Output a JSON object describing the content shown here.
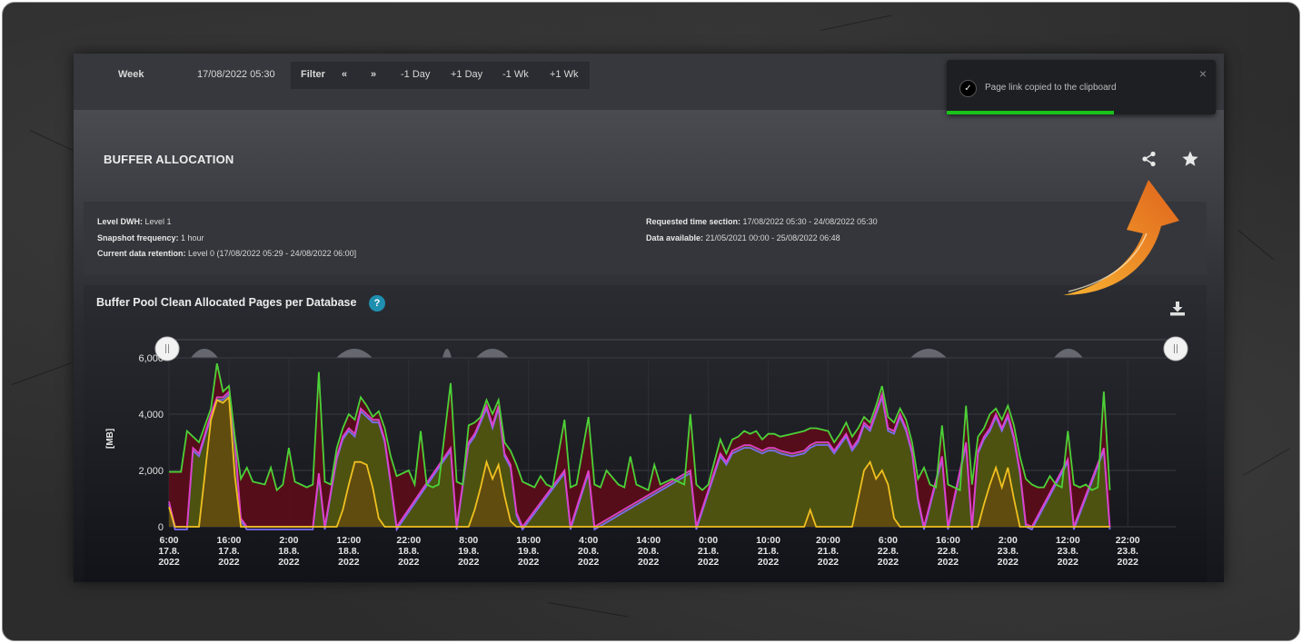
{
  "topbar": {
    "period_label": "Week",
    "datetime": "17/08/2022 05:30",
    "filter_label": "Filter",
    "nav_prev": "«",
    "nav_next": "»",
    "minus_day": "-1 Day",
    "plus_day": "+1 Day",
    "minus_week": "-1 Wk",
    "plus_week": "+1 Wk"
  },
  "toast": {
    "message": "Page link copied to the clipboard",
    "close": "×",
    "progress": 0.62
  },
  "section": {
    "title": "BUFFER ALLOCATION",
    "share_icon": "share-icon",
    "favorite_icon": "star-icon"
  },
  "info": {
    "level_label": "Level DWH:",
    "level_value": "Level 1",
    "snapshot_label": "Snapshot frequency:",
    "snapshot_value": "1 hour",
    "retention_label": "Current data retention:",
    "retention_value": "Level 0 (17/08/2022 05:29 - 24/08/2022 06:00]",
    "requested_label": "Requested time section:",
    "requested_value": "17/08/2022 05:30 - 24/08/2022 05:30",
    "available_label": "Data available:",
    "available_value": "21/05/2021 00:00 - 25/08/2022 06:48"
  },
  "chart": {
    "title": "Buffer Pool Clean Allocated Pages per Database",
    "help": "?",
    "download_icon": "download-icon",
    "colors": {
      "total": "#4cd137",
      "magenta": "#e040c8",
      "blue": "#7b6cf0",
      "yellow": "#f0c020",
      "base_fill": "#5a0d1a",
      "green_fill": "#4c5a10"
    }
  },
  "chart_data": {
    "type": "area",
    "ylabel": "[MB]",
    "ylim": [
      0,
      6000
    ],
    "yticks": [
      "0",
      "2,000",
      "4,000",
      "6,000"
    ],
    "grid": true,
    "xticks": [
      [
        "6:00",
        "17.8.",
        "2022"
      ],
      [
        "16:00",
        "17.8.",
        "2022"
      ],
      [
        "2:00",
        "18.8.",
        "2022"
      ],
      [
        "12:00",
        "18.8.",
        "2022"
      ],
      [
        "22:00",
        "18.8.",
        "2022"
      ],
      [
        "8:00",
        "19.8.",
        "2022"
      ],
      [
        "18:00",
        "19.8.",
        "2022"
      ],
      [
        "4:00",
        "20.8.",
        "2022"
      ],
      [
        "14:00",
        "20.8.",
        "2022"
      ],
      [
        "0:00",
        "21.8.",
        "2022"
      ],
      [
        "10:00",
        "21.8.",
        "2022"
      ],
      [
        "20:00",
        "21.8.",
        "2022"
      ],
      [
        "6:00",
        "22.8.",
        "2022"
      ],
      [
        "16:00",
        "22.8.",
        "2022"
      ],
      [
        "2:00",
        "23.8.",
        "2022"
      ],
      [
        "12:00",
        "23.8.",
        "2022"
      ],
      [
        "22:00",
        "23.8.",
        "2022"
      ]
    ],
    "x_hours_range": [
      0,
      168
    ],
    "series": [
      {
        "color": "#4cd137",
        "points": [
          [
            0,
            1950
          ],
          [
            2,
            1950
          ],
          [
            3,
            3400
          ],
          [
            5,
            3000
          ],
          [
            7,
            4200
          ],
          [
            8,
            5800
          ],
          [
            9,
            4800
          ],
          [
            10,
            5000
          ],
          [
            11,
            3200
          ],
          [
            12,
            1700
          ],
          [
            13,
            2100
          ],
          [
            14,
            1600
          ],
          [
            16,
            1500
          ],
          [
            17,
            2100
          ],
          [
            18,
            1300
          ],
          [
            19,
            1500
          ],
          [
            20,
            2800
          ],
          [
            21,
            1600
          ],
          [
            22,
            1500
          ],
          [
            23,
            1400
          ],
          [
            24,
            1500
          ],
          [
            25,
            5500
          ],
          [
            26,
            1600
          ],
          [
            27,
            1500
          ],
          [
            28,
            2800
          ],
          [
            29,
            3500
          ],
          [
            30,
            4000
          ],
          [
            31,
            3800
          ],
          [
            32,
            4600
          ],
          [
            33,
            4300
          ],
          [
            34,
            3900
          ],
          [
            35,
            4100
          ],
          [
            36,
            3500
          ],
          [
            37,
            2500
          ],
          [
            38,
            1800
          ],
          [
            40,
            2000
          ],
          [
            41,
            1500
          ],
          [
            42,
            3400
          ],
          [
            43,
            1500
          ],
          [
            44,
            1400
          ],
          [
            45,
            1500
          ],
          [
            47,
            5100
          ],
          [
            48,
            1600
          ],
          [
            49,
            1500
          ],
          [
            50,
            3600
          ],
          [
            51,
            3700
          ],
          [
            52,
            3900
          ],
          [
            53,
            4500
          ],
          [
            54,
            4000
          ],
          [
            55,
            4500
          ],
          [
            56,
            3000
          ],
          [
            57,
            2700
          ],
          [
            58,
            2200
          ],
          [
            59,
            1600
          ],
          [
            60,
            1500
          ],
          [
            61,
            1400
          ],
          [
            62,
            1800
          ],
          [
            63,
            1500
          ],
          [
            64,
            1400
          ],
          [
            66,
            3800
          ],
          [
            67,
            1400
          ],
          [
            68,
            1500
          ],
          [
            70,
            3900
          ],
          [
            71,
            1500
          ],
          [
            72,
            1400
          ],
          [
            73,
            2000
          ],
          [
            75,
            1500
          ],
          [
            76,
            1400
          ],
          [
            77,
            2500
          ],
          [
            78,
            1500
          ],
          [
            79,
            1400
          ],
          [
            80,
            1300
          ],
          [
            81,
            2200
          ],
          [
            82,
            1500
          ],
          [
            84,
            1700
          ],
          [
            86,
            1500
          ],
          [
            87,
            4000
          ],
          [
            88,
            1500
          ],
          [
            89,
            1300
          ],
          [
            90,
            1500
          ],
          [
            92,
            3100
          ],
          [
            93,
            2600
          ],
          [
            94,
            3100
          ],
          [
            95,
            3200
          ],
          [
            96,
            3400
          ],
          [
            97,
            3300
          ],
          [
            98,
            3400
          ],
          [
            99,
            3100
          ],
          [
            100,
            3300
          ],
          [
            101,
            3300
          ],
          [
            102,
            3200
          ],
          [
            104,
            3300
          ],
          [
            106,
            3400
          ],
          [
            107,
            3500
          ],
          [
            108,
            3500
          ],
          [
            110,
            3400
          ],
          [
            111,
            3000
          ],
          [
            112,
            3300
          ],
          [
            113,
            3700
          ],
          [
            114,
            3200
          ],
          [
            115,
            3500
          ],
          [
            116,
            3900
          ],
          [
            117,
            3700
          ],
          [
            118,
            4300
          ],
          [
            119,
            5000
          ],
          [
            120,
            3900
          ],
          [
            121,
            3700
          ],
          [
            122,
            4200
          ],
          [
            123,
            3800
          ],
          [
            124,
            3000
          ],
          [
            125,
            1700
          ],
          [
            126,
            2100
          ],
          [
            127,
            1500
          ],
          [
            128,
            1400
          ],
          [
            129,
            3600
          ],
          [
            130,
            1500
          ],
          [
            131,
            1400
          ],
          [
            132,
            1300
          ],
          [
            133,
            4300
          ],
          [
            134,
            1500
          ],
          [
            135,
            3200
          ],
          [
            136,
            3500
          ],
          [
            137,
            4000
          ],
          [
            138,
            4200
          ],
          [
            139,
            3800
          ],
          [
            140,
            4300
          ],
          [
            141,
            3600
          ],
          [
            142,
            2500
          ],
          [
            143,
            1700
          ],
          [
            144,
            1500
          ],
          [
            145,
            1400
          ],
          [
            146,
            1400
          ],
          [
            147,
            1800
          ],
          [
            148,
            1500
          ],
          [
            149,
            1400
          ],
          [
            150,
            3400
          ],
          [
            151,
            1500
          ],
          [
            152,
            1400
          ],
          [
            153,
            1500
          ],
          [
            154,
            1300
          ],
          [
            155,
            1400
          ],
          [
            156,
            4800
          ],
          [
            157,
            1300
          ]
        ]
      },
      {
        "color": "#e040c8",
        "points": [
          [
            0,
            900
          ],
          [
            1,
            0
          ],
          [
            3,
            0
          ],
          [
            4,
            2800
          ],
          [
            5,
            2600
          ],
          [
            7,
            4000
          ],
          [
            8,
            4600
          ],
          [
            9,
            4600
          ],
          [
            10,
            4800
          ],
          [
            11,
            3000
          ],
          [
            12,
            300
          ],
          [
            13,
            0
          ],
          [
            19,
            0
          ],
          [
            20,
            0
          ],
          [
            21,
            0
          ],
          [
            24,
            0
          ],
          [
            25,
            1900
          ],
          [
            26,
            0
          ],
          [
            28,
            2500
          ],
          [
            29,
            3200
          ],
          [
            30,
            3500
          ],
          [
            31,
            3300
          ],
          [
            32,
            4200
          ],
          [
            33,
            4000
          ],
          [
            34,
            3800
          ],
          [
            35,
            3800
          ],
          [
            36,
            3100
          ],
          [
            37,
            1600
          ],
          [
            38,
            0
          ],
          [
            47,
            2800
          ],
          [
            48,
            0
          ],
          [
            50,
            3000
          ],
          [
            51,
            3300
          ],
          [
            52,
            3800
          ],
          [
            53,
            4300
          ],
          [
            54,
            3600
          ],
          [
            55,
            4300
          ],
          [
            56,
            2600
          ],
          [
            57,
            2200
          ],
          [
            58,
            500
          ],
          [
            59,
            0
          ],
          [
            66,
            2000
          ],
          [
            67,
            0
          ],
          [
            70,
            2000
          ],
          [
            71,
            0
          ],
          [
            87,
            2000
          ],
          [
            88,
            0
          ],
          [
            92,
            2600
          ],
          [
            93,
            2300
          ],
          [
            94,
            2700
          ],
          [
            95,
            2800
          ],
          [
            96,
            2900
          ],
          [
            97,
            2900
          ],
          [
            98,
            2800
          ],
          [
            99,
            2700
          ],
          [
            100,
            2800
          ],
          [
            101,
            2800
          ],
          [
            102,
            2700
          ],
          [
            104,
            2600
          ],
          [
            106,
            2700
          ],
          [
            107,
            2900
          ],
          [
            108,
            3000
          ],
          [
            110,
            3000
          ],
          [
            111,
            2700
          ],
          [
            112,
            3000
          ],
          [
            113,
            3300
          ],
          [
            114,
            2800
          ],
          [
            115,
            3100
          ],
          [
            116,
            3700
          ],
          [
            117,
            3500
          ],
          [
            118,
            4100
          ],
          [
            119,
            4700
          ],
          [
            120,
            3500
          ],
          [
            121,
            3400
          ],
          [
            122,
            4000
          ],
          [
            123,
            3500
          ],
          [
            124,
            2700
          ],
          [
            125,
            1000
          ],
          [
            126,
            0
          ],
          [
            129,
            2500
          ],
          [
            130,
            0
          ],
          [
            133,
            3000
          ],
          [
            134,
            0
          ],
          [
            135,
            2700
          ],
          [
            136,
            3200
          ],
          [
            137,
            3500
          ],
          [
            138,
            4000
          ],
          [
            139,
            3500
          ],
          [
            140,
            4000
          ],
          [
            141,
            3200
          ],
          [
            142,
            2000
          ],
          [
            143,
            100
          ],
          [
            144,
            0
          ],
          [
            150,
            2400
          ],
          [
            151,
            0
          ],
          [
            156,
            2800
          ],
          [
            157,
            0
          ]
        ]
      },
      {
        "color": "#f0c020",
        "points": [
          [
            0,
            700
          ],
          [
            1,
            0
          ],
          [
            3,
            0
          ],
          [
            5,
            0
          ],
          [
            7,
            3800
          ],
          [
            8,
            4500
          ],
          [
            9,
            4400
          ],
          [
            10,
            4600
          ],
          [
            11,
            1800
          ],
          [
            12,
            0
          ],
          [
            25,
            0
          ],
          [
            28,
            0
          ],
          [
            29,
            600
          ],
          [
            30,
            1500
          ],
          [
            31,
            2300
          ],
          [
            32,
            2300
          ],
          [
            33,
            2200
          ],
          [
            34,
            1400
          ],
          [
            35,
            300
          ],
          [
            36,
            0
          ],
          [
            50,
            0
          ],
          [
            51,
            600
          ],
          [
            52,
            1400
          ],
          [
            53,
            2300
          ],
          [
            54,
            1700
          ],
          [
            55,
            2200
          ],
          [
            56,
            1100
          ],
          [
            57,
            200
          ],
          [
            58,
            0
          ],
          [
            104,
            0
          ],
          [
            106,
            0
          ],
          [
            107,
            600
          ],
          [
            108,
            0
          ],
          [
            114,
            0
          ],
          [
            115,
            1000
          ],
          [
            116,
            2000
          ],
          [
            117,
            2300
          ],
          [
            118,
            1700
          ],
          [
            119,
            2000
          ],
          [
            120,
            1500
          ],
          [
            121,
            300
          ],
          [
            122,
            0
          ],
          [
            135,
            0
          ],
          [
            136,
            800
          ],
          [
            137,
            1500
          ],
          [
            138,
            2100
          ],
          [
            139,
            1400
          ],
          [
            140,
            2100
          ],
          [
            141,
            1000
          ],
          [
            142,
            0
          ],
          [
            157,
            0
          ]
        ]
      }
    ]
  }
}
